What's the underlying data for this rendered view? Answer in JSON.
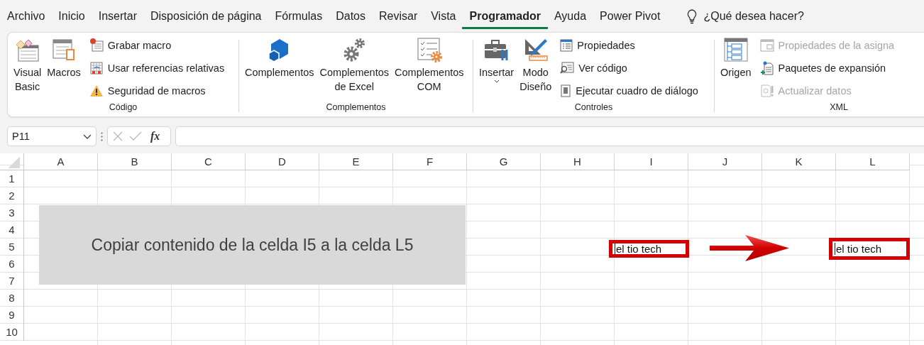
{
  "menu_tabs": [
    {
      "label": "Archivo",
      "selected": false
    },
    {
      "label": "Inicio",
      "selected": false
    },
    {
      "label": "Insertar",
      "selected": false
    },
    {
      "label": "Disposición de página",
      "selected": false
    },
    {
      "label": "Fórmulas",
      "selected": false
    },
    {
      "label": "Datos",
      "selected": false
    },
    {
      "label": "Revisar",
      "selected": false
    },
    {
      "label": "Vista",
      "selected": false
    },
    {
      "label": "Programador",
      "selected": true
    },
    {
      "label": "Ayuda",
      "selected": false
    },
    {
      "label": "Power Pivot",
      "selected": false
    }
  ],
  "tell_me": "¿Qué desea hacer?",
  "ribbon_groups": [
    {
      "label": "Código",
      "items": [
        {
          "kind": "large",
          "label": "Visual\nBasic",
          "disabled": false,
          "dropdown": false
        },
        {
          "kind": "large",
          "label": "Macros",
          "disabled": false,
          "dropdown": false
        },
        {
          "kind": "small",
          "label": "Grabar macro",
          "disabled": false
        },
        {
          "kind": "small",
          "label": "Usar referencias relativas",
          "disabled": false
        },
        {
          "kind": "small",
          "label": "Seguridad de macros",
          "disabled": false
        }
      ]
    },
    {
      "label": "Complementos",
      "items": [
        {
          "kind": "large",
          "label": "Complementos",
          "disabled": false,
          "dropdown": false
        },
        {
          "kind": "large",
          "label": "Complementos\nde Excel",
          "disabled": false,
          "dropdown": false
        },
        {
          "kind": "large",
          "label": "Complementos\nCOM",
          "disabled": false,
          "dropdown": false
        }
      ]
    },
    {
      "label": "Controles",
      "items": [
        {
          "kind": "large",
          "label": "Insertar",
          "disabled": false,
          "dropdown": true
        },
        {
          "kind": "large",
          "label": "Modo\nDiseño",
          "disabled": false,
          "dropdown": false
        },
        {
          "kind": "small",
          "label": "Propiedades",
          "disabled": false
        },
        {
          "kind": "small",
          "label": "Ver código",
          "disabled": false
        },
        {
          "kind": "small",
          "label": "Ejecutar cuadro de diálogo",
          "disabled": false
        }
      ]
    },
    {
      "label": "XML",
      "items": [
        {
          "kind": "large",
          "label": "Origen",
          "disabled": false,
          "dropdown": false
        },
        {
          "kind": "small",
          "label": "Propiedades de la asigna",
          "disabled": true
        },
        {
          "kind": "small",
          "label": "Paquetes de expansión",
          "disabled": false
        },
        {
          "kind": "small",
          "label": "Actualizar datos",
          "disabled": true
        }
      ]
    }
  ],
  "formula_bar": {
    "name_box": "P11",
    "fx": "fx"
  },
  "sheet": {
    "columns": [
      "A",
      "B",
      "C",
      "D",
      "E",
      "F",
      "G",
      "H",
      "I",
      "J",
      "K",
      "L"
    ],
    "rows": [
      "1",
      "2",
      "3",
      "4",
      "5",
      "6",
      "7",
      "8",
      "9",
      "10"
    ],
    "note": "Copiar contenido de la celda I5 a la celda L5",
    "text_boxes": [
      {
        "text": "el tio tech"
      },
      {
        "text": "el tio tech"
      }
    ]
  }
}
